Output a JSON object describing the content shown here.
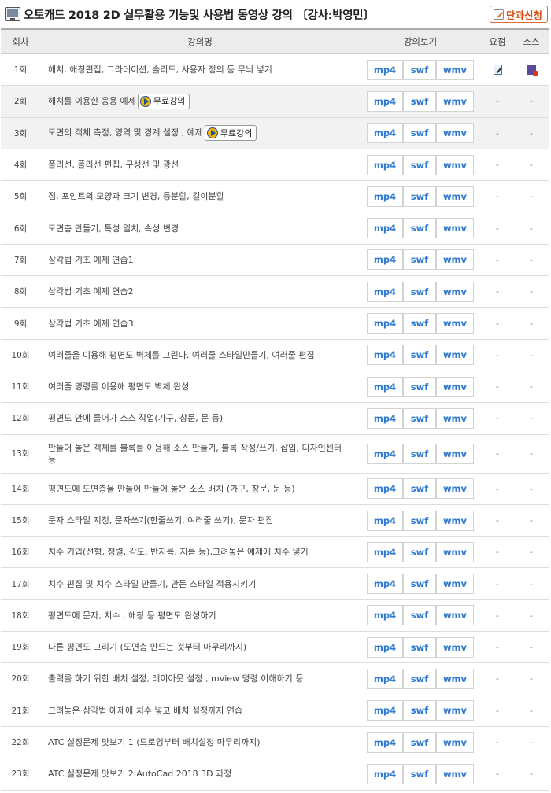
{
  "page": {
    "title": "오토캐드 2018 2D 실무활용 기능및 사용법 동영상 강의 〔강사:박영민〕",
    "enroll_label": "단과신청"
  },
  "header": {
    "num": "회차",
    "title": "강의명",
    "view": "강의보기",
    "summary": "요점",
    "source": "소스"
  },
  "formats": [
    "mp4",
    "swf",
    "wmv"
  ],
  "free_label": "무료강의",
  "dash": "-",
  "lectures": [
    {
      "num": "1회",
      "title": "해치, 해칭편집, 그라데이션, 솔리드, 사용자 정의 등 무늬 넣기"
    },
    {
      "num": "2회",
      "title": "해치를 이용한 응용 예제"
    },
    {
      "num": "3회",
      "title": "도면의 객체 측정, 영역 및 경계 설정 , 예제"
    },
    {
      "num": "4회",
      "title": "폴리선, 폴리선 편집, 구성선 및 광선"
    },
    {
      "num": "5회",
      "title": "점, 포인트의 모양과 크기 변경, 등분할, 길이분할"
    },
    {
      "num": "6회",
      "title": "도면층 만들기, 특성 일치, 속성 변경"
    },
    {
      "num": "7회",
      "title": "삼각법 기초 예제 연습1"
    },
    {
      "num": "8회",
      "title": "삼각법 기초 예제 연습2"
    },
    {
      "num": "9회",
      "title": "삼각법 기초 예제 연습3"
    },
    {
      "num": "10회",
      "title": "여러줄을 이용해 평면도 벽체를 그린다. 여러줄 스타일만들기, 여러줄 편집"
    },
    {
      "num": "11회",
      "title": "여러줄 명령를 이용해 평면도 벽체 완성"
    },
    {
      "num": "12회",
      "title": "평면도 안에 들어가 소스 작업(가구, 창문, 문 등)"
    },
    {
      "num": "13회",
      "title": "만들어 놓은 객체를 블록를 이용해 소스 만들기, 블록 작성/쓰기, 삽입, 디자인센터 등"
    },
    {
      "num": "14회",
      "title": "평면도에 도면층을 만들어 만들어 놓은 소스 배치 (가구, 창문, 문 등)"
    },
    {
      "num": "15회",
      "title": "문자 스타일 지정, 문자쓰기(한줄쓰기, 여러줄 쓰기), 문자 편집"
    },
    {
      "num": "16회",
      "title": "치수 기입(선형, 정렬, 각도, 반지름, 지름 등),그려놓은 예제에 치수 넣기"
    },
    {
      "num": "17회",
      "title": "치수 편집 및 치수 스타일 만들기, 만든 스타일 적용시키기"
    },
    {
      "num": "18회",
      "title": "평면도에 문자, 치수 , 해칭 등 평면도 완성하기"
    },
    {
      "num": "19회",
      "title": "다른 평면도 그리기 (도면층 만드는 것부터 마무리까지)"
    },
    {
      "num": "20회",
      "title": "출력를 하기 위한 배치 설정, 레이아웃 설정 , mview 명령 이해하기 등"
    },
    {
      "num": "21회",
      "title": "그려놓은 삼각법 예제에 치수 넣고 배치 설정까지 연습"
    },
    {
      "num": "22회",
      "title": "ATC 실정문제 맛보기 1 (드로잉부터 배치설정 마무리까지)"
    },
    {
      "num": "23회",
      "title": "ATC 실정문제 맛보기 2 AutoCad 2018 3D 과정"
    }
  ]
}
